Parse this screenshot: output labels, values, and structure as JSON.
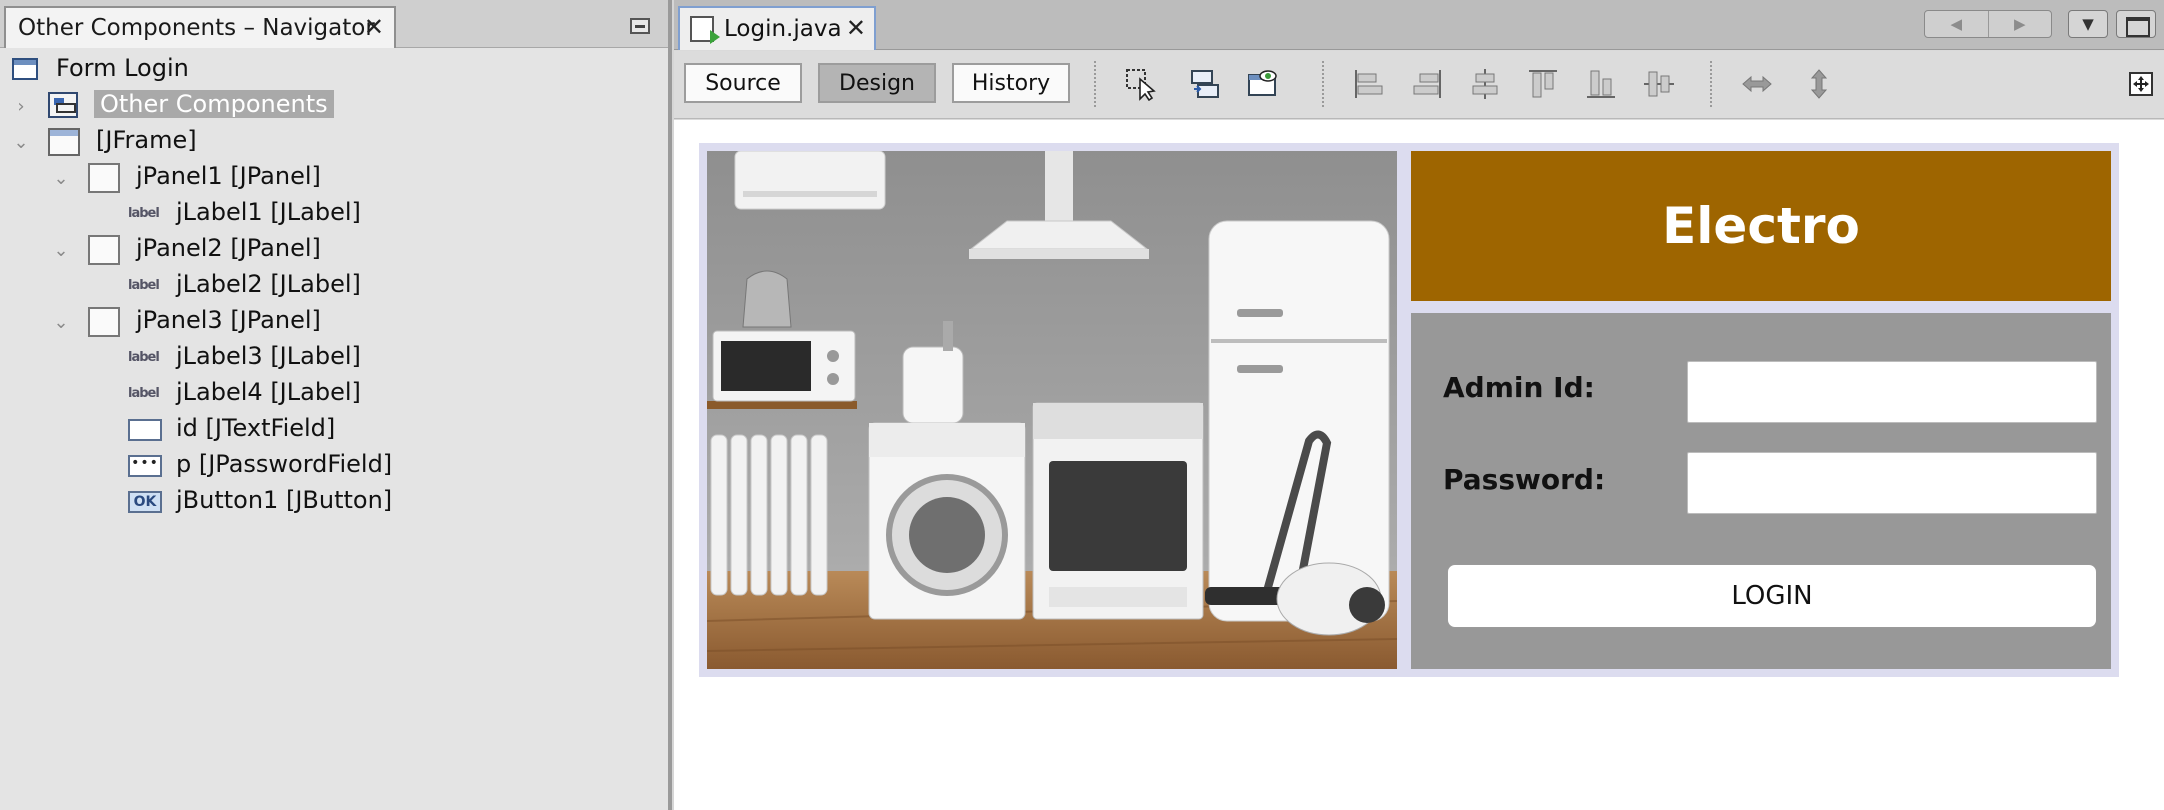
{
  "navigator": {
    "tab_title": "Other Components – Navigator",
    "close": "✕",
    "tree": [
      {
        "label": "Form Login",
        "icon": "form-icon"
      },
      {
        "label": "Other Components",
        "icon": "other-components-icon",
        "selected": true,
        "expander": "›"
      },
      {
        "label": "[JFrame]",
        "icon": "jframe-icon",
        "expander": "⌄"
      },
      {
        "label": "jPanel1 [JPanel]",
        "icon": "jpanel-icon",
        "expander": "⌄"
      },
      {
        "label": "jLabel1 [JLabel]",
        "icon": "jlabel-icon",
        "icon_text": "label"
      },
      {
        "label": "jPanel2 [JPanel]",
        "icon": "jpanel-icon",
        "expander": "⌄"
      },
      {
        "label": "jLabel2 [JLabel]",
        "icon": "jlabel-icon",
        "icon_text": "label"
      },
      {
        "label": "jPanel3 [JPanel]",
        "icon": "jpanel-icon",
        "expander": "⌄"
      },
      {
        "label": "jLabel3 [JLabel]",
        "icon": "jlabel-icon",
        "icon_text": "label"
      },
      {
        "label": "jLabel4 [JLabel]",
        "icon": "jlabel-icon",
        "icon_text": "label"
      },
      {
        "label": "id [JTextField]",
        "icon": "jtextfield-icon"
      },
      {
        "label": "p [JPasswordField]",
        "icon": "jpasswordfield-icon",
        "icon_text": "•••"
      },
      {
        "label": "jButton1 [JButton]",
        "icon": "jbutton-icon",
        "icon_text": "OK"
      }
    ]
  },
  "editor": {
    "tab_title": "Login.java",
    "close": "✕",
    "nav_left": "◀",
    "nav_right": "▶",
    "dropdown": "▼",
    "toolbar": {
      "source": "Source",
      "design": "Design",
      "history": "History"
    },
    "form": {
      "brand": "Electro",
      "admin_label": "Admin Id:",
      "password_label": "Password:",
      "admin_value": "",
      "password_value": "",
      "login_label": "LOGIN",
      "photo_alt": "appliances-photo"
    },
    "colors": {
      "header_bg": "#9e6500",
      "panel_bg": "#989898",
      "frame_bg": "#dcdcef"
    }
  }
}
